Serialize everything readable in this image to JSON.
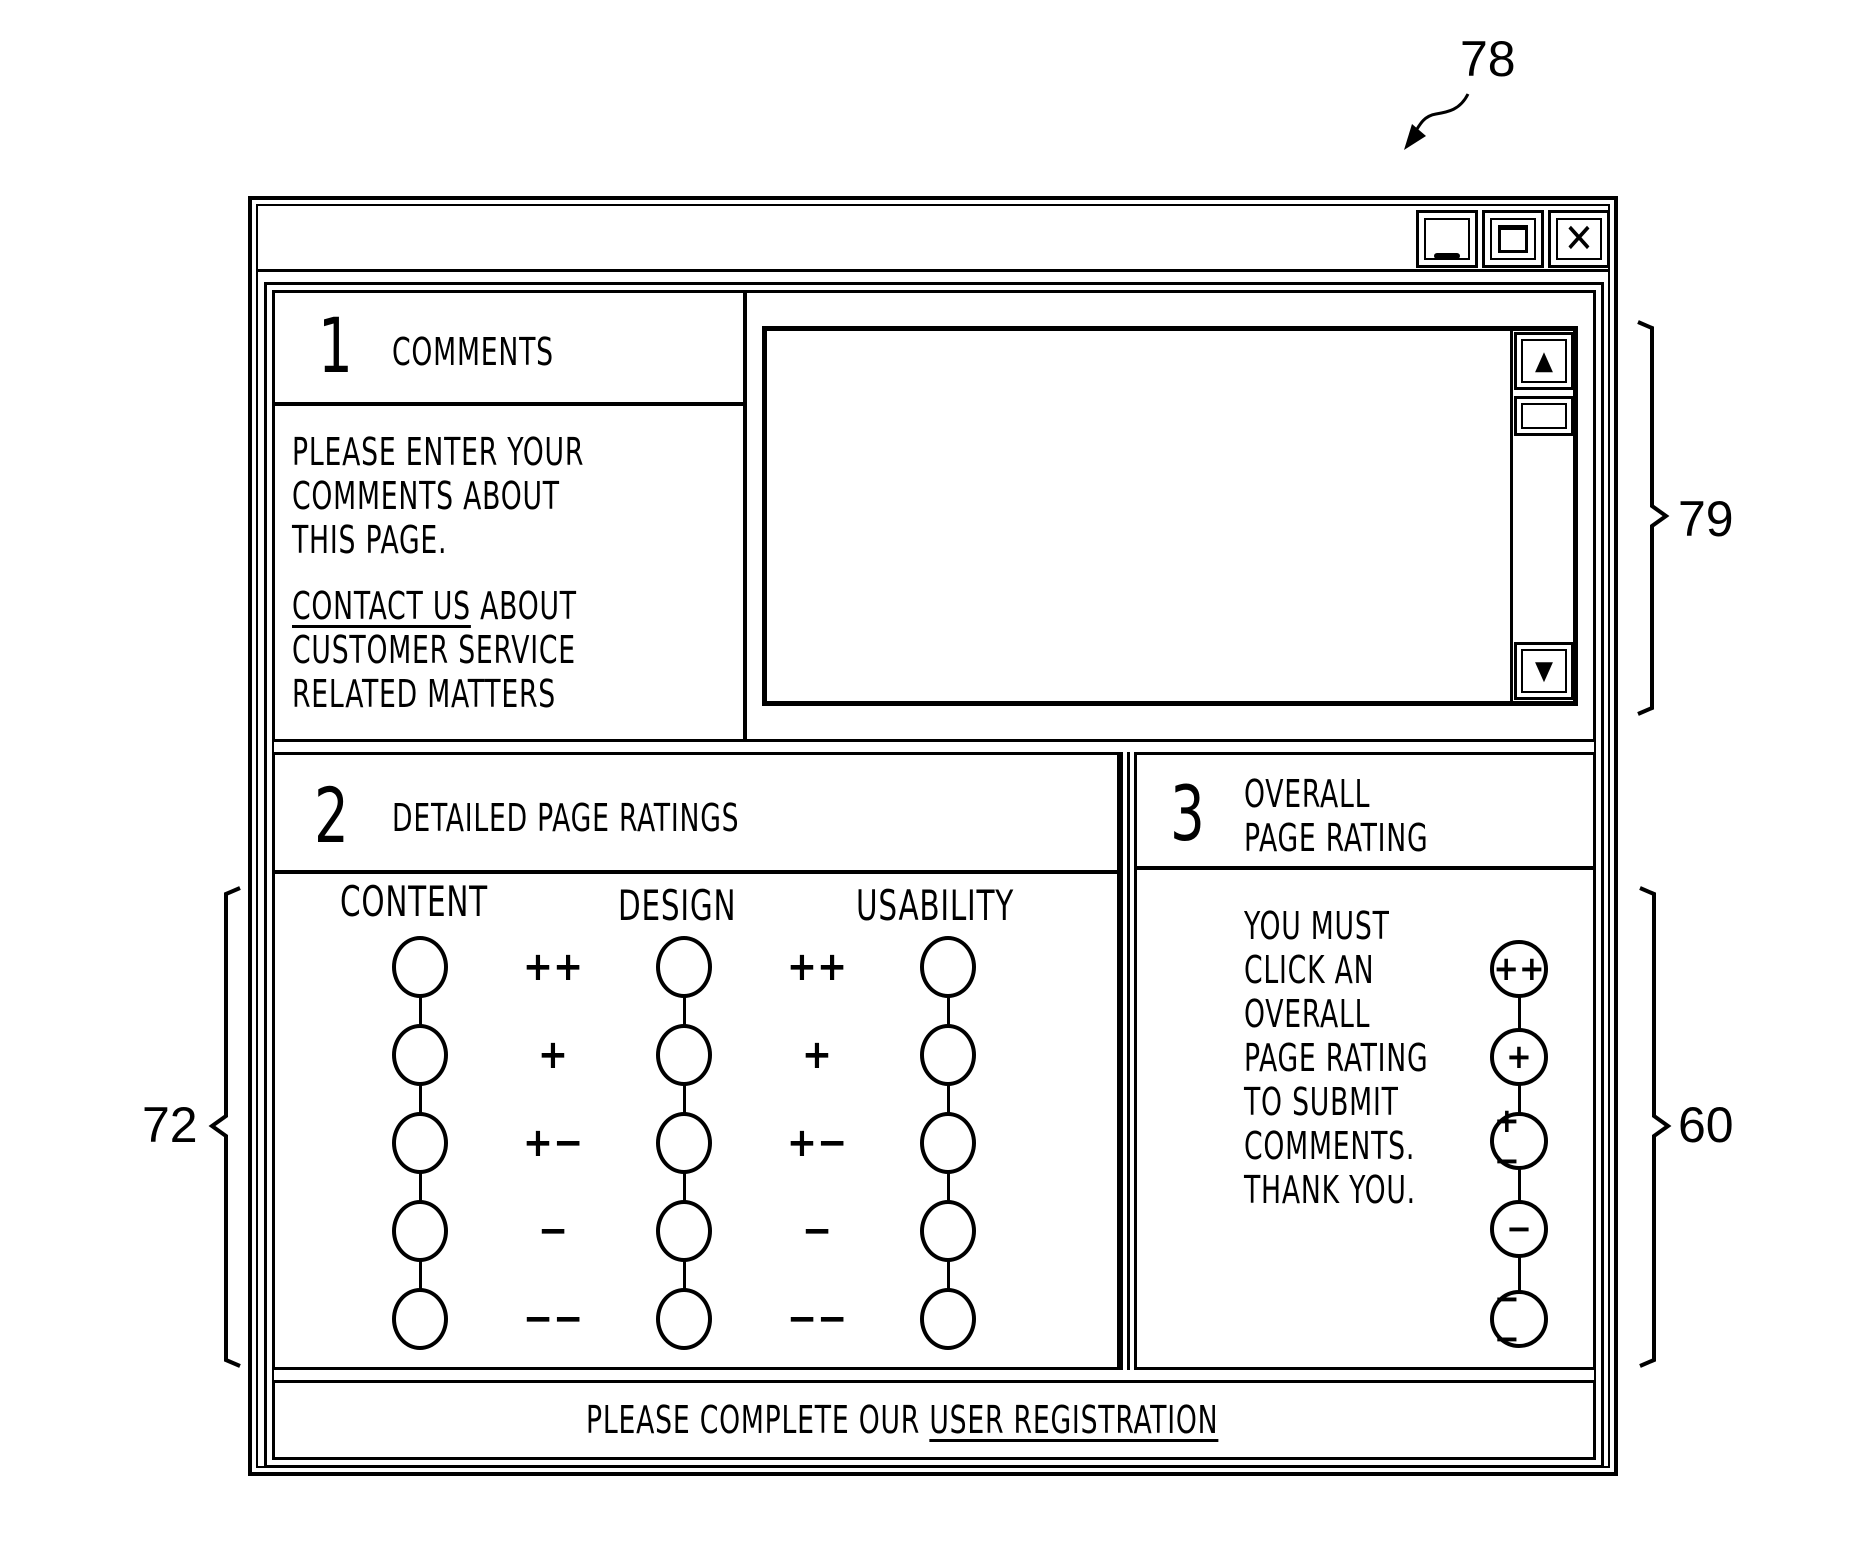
{
  "figure_refs": {
    "window": "78",
    "comments_area": "79",
    "detailed_ratings": "72",
    "overall_rating": "60"
  },
  "titlebar": {
    "minimize_icon": "minimize-icon",
    "maximize_icon": "maximize-icon",
    "close_icon": "close-icon",
    "minimize_glyph": "_",
    "maximize_glyph": "☐",
    "close_glyph": "✕"
  },
  "comments": {
    "number": "1",
    "title": "COMMENTS",
    "instructions": [
      "PLEASE ENTER YOUR",
      "COMMENTS ABOUT",
      "THIS PAGE."
    ],
    "contact_link": "CONTACT US",
    "contact_rest": [
      " ABOUT",
      "CUSTOMER SERVICE",
      "RELATED MATTERS"
    ],
    "textarea_value": "",
    "scroll_up_glyph": "▲",
    "scroll_down_glyph": "▼"
  },
  "detailed": {
    "number": "2",
    "title": "DETAILED PAGE RATINGS",
    "columns": [
      "CONTENT",
      "DESIGN",
      "USABILITY"
    ],
    "scale": [
      "++",
      "+",
      "+−",
      "−",
      "−−"
    ],
    "selected": [
      null,
      null,
      null
    ]
  },
  "overall": {
    "number": "3",
    "title": [
      "OVERALL",
      "PAGE RATING"
    ],
    "message": [
      "YOU MUST",
      "CLICK AN",
      "OVERALL",
      "PAGE RATING",
      "TO SUBMIT",
      "COMMENTS.",
      "THANK YOU."
    ],
    "options": [
      "++",
      "+",
      "+−",
      "−",
      "−−"
    ],
    "selected": null
  },
  "footer": {
    "prefix": "PLEASE COMPLETE OUR ",
    "link": "USER REGISTRATION"
  }
}
